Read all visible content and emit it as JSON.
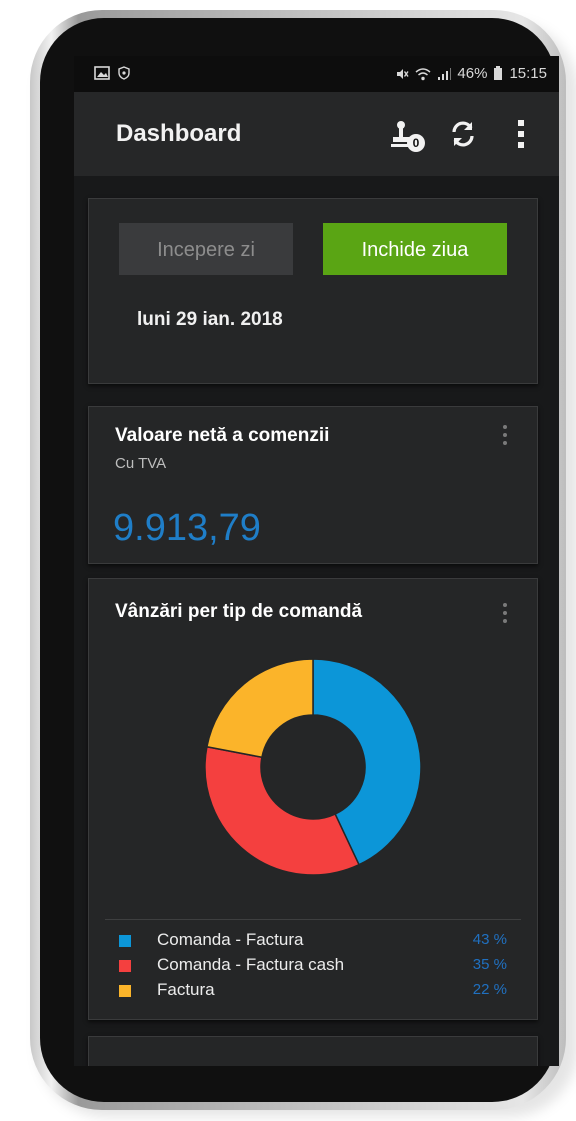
{
  "status_bar": {
    "battery": "46%",
    "time": "15:15",
    "left_icons": [
      "gallery-icon",
      "shield-icon"
    ],
    "right_icons": [
      "mute-icon",
      "wifi-icon",
      "signal-icon",
      "battery-icon"
    ]
  },
  "app_bar": {
    "title": "Dashboard",
    "badge_count": "0",
    "icons": [
      "stamp-icon",
      "refresh-icon",
      "more-vert-icon"
    ]
  },
  "day_card": {
    "start_label": "Incepere zi",
    "close_label": "Inchide ziua",
    "date": "luni 29 ian. 2018",
    "colors": {
      "close_button": "#5aa514",
      "start_button": "#3a3b3d"
    }
  },
  "net_value_card": {
    "title": "Valoare netă a comenzii",
    "subtitle": "Cu TVA",
    "value": "9.913,79",
    "value_color": "#1f7ec8"
  },
  "sales_card": {
    "title": "Vânzări per tip de comandă",
    "chart_data": {
      "type": "pie",
      "categories": [
        "Comanda - Factura",
        "Comanda - Factura cash",
        "Factura"
      ],
      "values": [
        43,
        35,
        22
      ],
      "value_labels": [
        "43 %",
        "35 %",
        "22 %"
      ],
      "colors": [
        "#0c96d8",
        "#f4403f",
        "#fbb42a"
      ],
      "donut": true,
      "legend_position": "bottom"
    }
  }
}
